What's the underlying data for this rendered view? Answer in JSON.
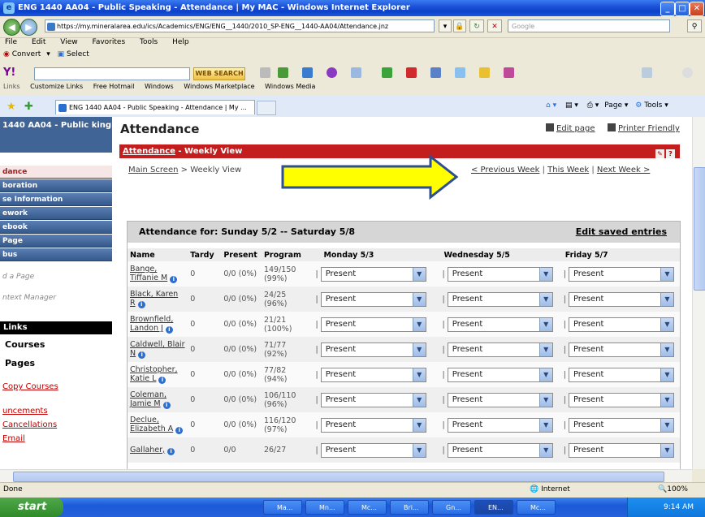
{
  "window": {
    "title": "ENG 1440 AA04 - Public Speaking - Attendance | My MAC - Windows Internet Explorer"
  },
  "address": {
    "url": "https://my.mineralarea.edu/ics/Academics/ENG/ENG__1440/2010_SP-ENG__1440-AA04/Attendance.jnz",
    "search_placeholder": "Google"
  },
  "menu": [
    "File",
    "Edit",
    "View",
    "Favorites",
    "Tools",
    "Help"
  ],
  "convert_bar": {
    "convert": "Convert",
    "select": "Select"
  },
  "toolbar": {
    "web_search": "WEB SEARCH"
  },
  "links_bar": {
    "label": "Links",
    "items": [
      "Customize Links",
      "Free Hotmail",
      "Windows",
      "Windows Marketplace",
      "Windows Media"
    ]
  },
  "tab": {
    "title": "ENG 1440 AA04 - Public Speaking - Attendance | My ..."
  },
  "command_bar": {
    "page": "Page",
    "tools": "Tools"
  },
  "sidebar": {
    "course_title": "1440 AA04 - Public king",
    "nav": [
      "dance",
      "boration",
      "se Information",
      "ework",
      "ebook",
      "Page",
      "bus"
    ],
    "gray_items": [
      "d a Page",
      "ntext Manager"
    ],
    "links_header": "Links",
    "bold_items": [
      "Courses",
      "Pages"
    ],
    "red_items": [
      "Copy Courses",
      "uncements",
      "Cancellations",
      "Email"
    ]
  },
  "page": {
    "heading": "Attendance",
    "edit_page": "Edit page",
    "printer_friendly": "Printer Friendly",
    "bar_link": "Attendance",
    "bar_suffix": " - Weekly View",
    "crumb_main": "Main Screen",
    "crumb_sep": " > ",
    "crumb_current": "Weekly View",
    "prev_week": "< Previous Week",
    "this_week": "This Week",
    "next_week": "Next Week >",
    "nav_sep": " | "
  },
  "attendance": {
    "header": "Attendance for: Sunday 5/2 -- Saturday 5/8",
    "edit_saved": "Edit saved entries",
    "columns": [
      "Name",
      "Tardy",
      "Present",
      "Program",
      "Monday 5/3",
      "Wednesday 5/5",
      "Friday 5/7"
    ],
    "rows": [
      {
        "name": "Bange, Tiffanie M",
        "tardy": "0",
        "present": "0/0 (0%)",
        "program": "149/150 (99%)",
        "mon": "Present",
        "wed": "Present",
        "fri": "Present"
      },
      {
        "name": "Black, Karen R",
        "tardy": "0",
        "present": "0/0 (0%)",
        "program": "24/25 (96%)",
        "mon": "Present",
        "wed": "Present",
        "fri": "Present"
      },
      {
        "name": "Brownfield, Landon J",
        "tardy": "0",
        "present": "0/0 (0%)",
        "program": "21/21 (100%)",
        "mon": "Present",
        "wed": "Present",
        "fri": "Present"
      },
      {
        "name": "Caldwell, Blair N",
        "tardy": "0",
        "present": "0/0 (0%)",
        "program": "71/77 (92%)",
        "mon": "Present",
        "wed": "Present",
        "fri": "Present"
      },
      {
        "name": "Christopher, Katie L",
        "tardy": "0",
        "present": "0/0 (0%)",
        "program": "77/82 (94%)",
        "mon": "Present",
        "wed": "Present",
        "fri": "Present"
      },
      {
        "name": "Coleman, Jamie M",
        "tardy": "0",
        "present": "0/0 (0%)",
        "program": "106/110 (96%)",
        "mon": "Present",
        "wed": "Present",
        "fri": "Present"
      },
      {
        "name": "Declue, Elizabeth A",
        "tardy": "0",
        "present": "0/0 (0%)",
        "program": "116/120 (97%)",
        "mon": "Present",
        "wed": "Present",
        "fri": "Present"
      },
      {
        "name": "Gallaher,",
        "tardy": "0",
        "present": "0/0",
        "program": "26/27",
        "mon": "Present",
        "wed": "Present",
        "fri": "Present"
      }
    ]
  },
  "status": {
    "text": "Done",
    "zone": "Internet",
    "zoom": "100%"
  },
  "taskbar": {
    "start": "start",
    "tasks": [
      "Ma...",
      "Mn...",
      "Mc...",
      "Bri...",
      "Gn...",
      "EN...",
      "Mc..."
    ],
    "clock": "9:14 AM"
  },
  "colors": {
    "accent_red": "#c41d1d",
    "sidebar_blue": "#3f6495",
    "arrow_yellow": "#ffff00",
    "arrow_border": "#2f4f8f"
  }
}
